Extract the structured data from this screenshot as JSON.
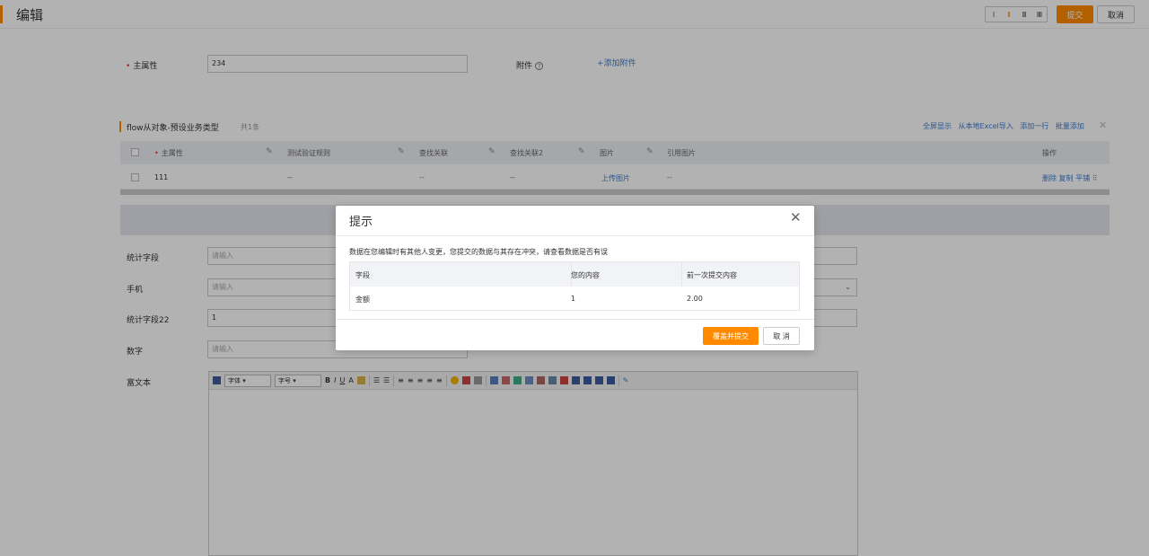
{
  "header": {
    "title": "编辑",
    "view_modes": [
      "I",
      "II",
      "III",
      "IIII"
    ],
    "active_view_mode": "II",
    "submit_label": "提交",
    "cancel_label": "取消"
  },
  "form": {
    "main_attr_label": "主属性",
    "main_attr_value": "234",
    "attachment_label": "附件",
    "add_attachment": "+添加附件",
    "fields": [
      {
        "label": "统计字段",
        "placeholder": "请输入"
      },
      {
        "label": "手机",
        "placeholder": "请输入"
      },
      {
        "label": "统计字段22",
        "value": "1"
      },
      {
        "label": "数字",
        "placeholder": "请输入"
      },
      {
        "label": "富文本"
      }
    ]
  },
  "subtable": {
    "title": "flow从对象-预设业务类型",
    "count": "共1条",
    "actions": [
      "全屏显示",
      "从本地Excel导入",
      "添加一行",
      "批量添加"
    ],
    "columns": [
      "主属性",
      "测试验证规则",
      "查找关联",
      "查找关联2",
      "图片",
      "引用图片",
      "操作"
    ],
    "row": {
      "main": "111",
      "rule": "--",
      "lookup": "--",
      "lookup2": "--",
      "image": "上传图片",
      "ref_image": "--",
      "ops": [
        "删除",
        "复制",
        "平铺"
      ]
    }
  },
  "editor": {
    "font_select": "字体",
    "size_select": "字号",
    "buttons": [
      "B",
      "I",
      "U",
      "A"
    ]
  },
  "dialog": {
    "title": "提示",
    "message": "数据在您编辑时有其他人变更，您提交的数据与其存在冲突，请查看数据是否有误",
    "table_headers": [
      "字段",
      "您的内容",
      "前一次提交内容"
    ],
    "rows": [
      {
        "field": "金额",
        "yours": "1",
        "previous": "2.00"
      }
    ],
    "confirm_label": "覆盖并提交",
    "cancel_label": "取 消"
  },
  "colors": {
    "accent": "#ff8a00",
    "link": "#3a7bd5"
  }
}
